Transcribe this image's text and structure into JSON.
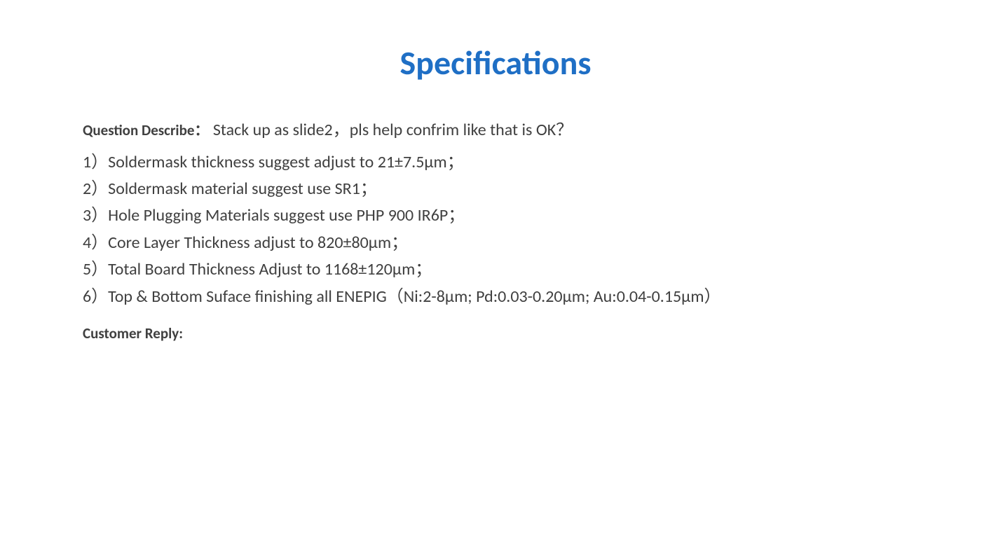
{
  "title": "Specifications",
  "question_label": "Question Describe：",
  "question_text": "Stack up as slide2，pls help confrim like that is OK？",
  "items": [
    "1）Soldermask thickness suggest adjust to 21±7.5μm；",
    "2）Soldermask material suggest use SR1；",
    "3）Hole Plugging Materials suggest use PHP 900 IR6P；",
    "4）Core Layer Thickness adjust to 820±80μm；",
    "5）Total Board Thickness Adjust to 1168±120μm；",
    "6）Top & Bottom Suface finishing all ENEPIG（Ni:2-8μm; Pd:0.03-0.20μm; Au:0.04-0.15μm）"
  ],
  "customer_reply_label": "Customer Reply:"
}
